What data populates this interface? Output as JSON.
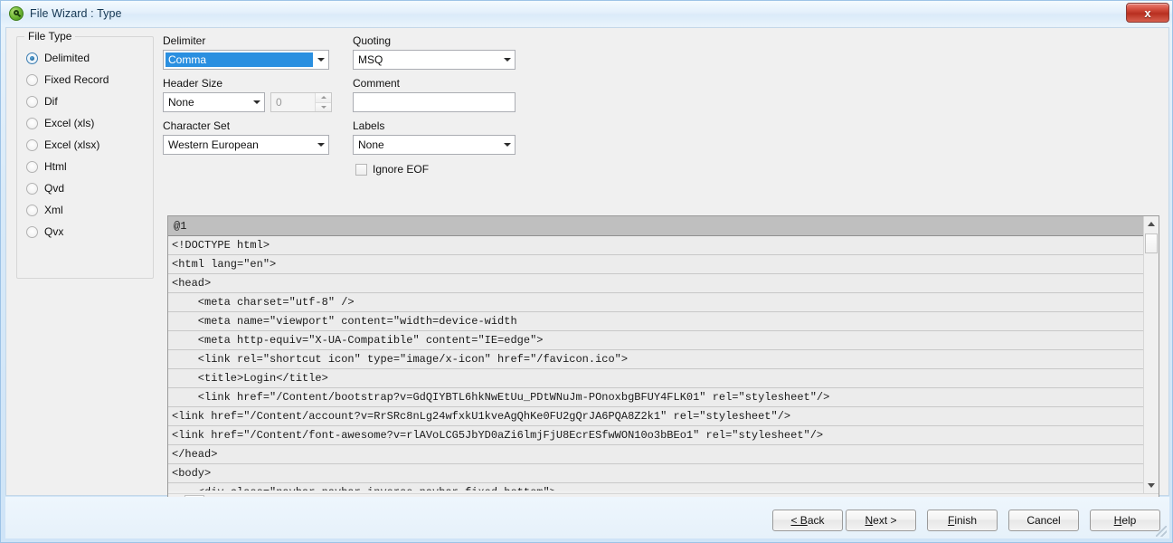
{
  "window": {
    "title": "File Wizard : Type",
    "app_icon": "qlikview-q-icon",
    "close_label": "x"
  },
  "file_type": {
    "group_label": "File Type",
    "options": [
      {
        "label": "Delimited",
        "checked": true
      },
      {
        "label": "Fixed Record",
        "checked": false
      },
      {
        "label": "Dif",
        "checked": false
      },
      {
        "label": "Excel (xls)",
        "checked": false
      },
      {
        "label": "Excel (xlsx)",
        "checked": false
      },
      {
        "label": "Html",
        "checked": false
      },
      {
        "label": "Qvd",
        "checked": false
      },
      {
        "label": "Xml",
        "checked": false
      },
      {
        "label": "Qvx",
        "checked": false
      }
    ]
  },
  "settings": {
    "delimiter_label": "Delimiter",
    "delimiter_value": "Comma",
    "header_size_label": "Header Size",
    "header_size_value": "None",
    "header_size_number": "0",
    "character_set_label": "Character Set",
    "character_set_value": "Western European",
    "quoting_label": "Quoting",
    "quoting_value": "MSQ",
    "comment_label": "Comment",
    "comment_value": "",
    "labels_label": "Labels",
    "labels_value": "None",
    "ignore_eof_label": "Ignore EOF",
    "ignore_eof_checked": false
  },
  "preview": {
    "column_header": "@1",
    "rows": [
      "<!DOCTYPE html>",
      "<html lang=\"en\">",
      "<head>",
      "    <meta charset=\"utf-8\" />",
      "    <meta name=\"viewport\" content=\"width=device-width",
      "    <meta http-equiv=\"X-UA-Compatible\" content=\"IE=edge\">",
      "    <link rel=\"shortcut icon\" type=\"image/x-icon\" href=\"/favicon.ico\">",
      "    <title>Login</title>",
      "    <link href=\"/Content/bootstrap?v=GdQIYBTL6hkNwEtUu_PDtWNuJm-POnoxbgBFUY4FLK01\" rel=\"stylesheet\"/>",
      "<link href=\"/Content/account?v=RrSRc8nLg24wfxkU1kveAgQhKe0FU2gQrJA6PQA8Z2k1\" rel=\"stylesheet\"/>",
      "<link href=\"/Content/font-awesome?v=rlAVoLCG5JbYD0aZi6lmjFjU8EcrESfwWON10o3bBEo1\" rel=\"stylesheet\"/>",
      "</head>",
      "<body>",
      "    <div class=\"navbar navbar-inverse navbar-fixed-bottom\">"
    ]
  },
  "footer": {
    "back": {
      "pre": "",
      "mnemonic": "< B",
      "post": "ack"
    },
    "next": {
      "pre": "",
      "mnemonic": "N",
      "post": "ext >"
    },
    "finish": {
      "pre": "",
      "mnemonic": "F",
      "post": "inish"
    },
    "cancel": {
      "pre": "Cancel",
      "mnemonic": "",
      "post": ""
    },
    "help": {
      "pre": "",
      "mnemonic": "H",
      "post": "elp"
    }
  }
}
